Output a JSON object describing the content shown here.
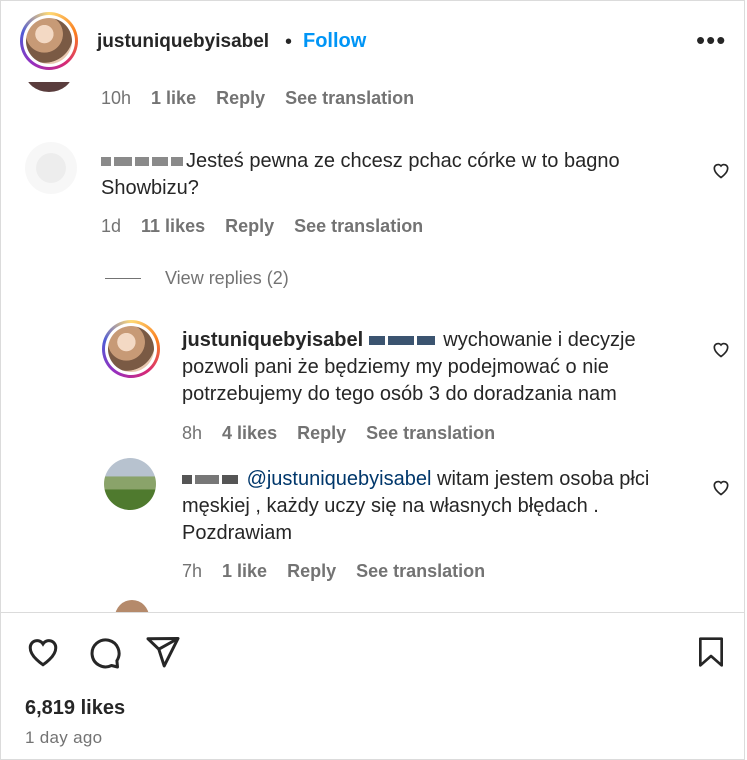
{
  "header": {
    "username": "justuniquebyisabel",
    "separator": "•",
    "follow_label": "Follow",
    "more_label": "•••"
  },
  "comments": [
    {
      "meta": {
        "time": "10h",
        "likes": "1 like",
        "reply": "Reply",
        "translate": "See translation"
      }
    },
    {
      "text": "Jesteś pewna ze chcesz pchac córke w to bagno Showbizu?",
      "meta": {
        "time": "1d",
        "likes": "11 likes",
        "reply": "Reply",
        "translate": "See translation"
      }
    },
    {
      "username": "justuniquebyisabel",
      "text": "wychowanie i decyzje pozwoli pani że będziemy my podejmować o nie potrzebujemy do tego osób 3 do doradzania nam",
      "meta": {
        "time": "8h",
        "likes": "4 likes",
        "reply": "Reply",
        "translate": "See translation"
      }
    },
    {
      "mention": "@justuniquebyisabel",
      "text": "witam jestem osoba płci męskiej , każdy uczy się na własnych błędach . Pozdrawiam",
      "meta": {
        "time": "7h",
        "likes": "1 like",
        "reply": "Reply",
        "translate": "See translation"
      }
    }
  ],
  "view_replies": "View replies (2)",
  "post": {
    "likes": "6,819 likes",
    "time_ago": "1 day ago"
  },
  "colors": {
    "accent": "#0095f6",
    "muted": "#737373",
    "mention": "#00376b"
  }
}
